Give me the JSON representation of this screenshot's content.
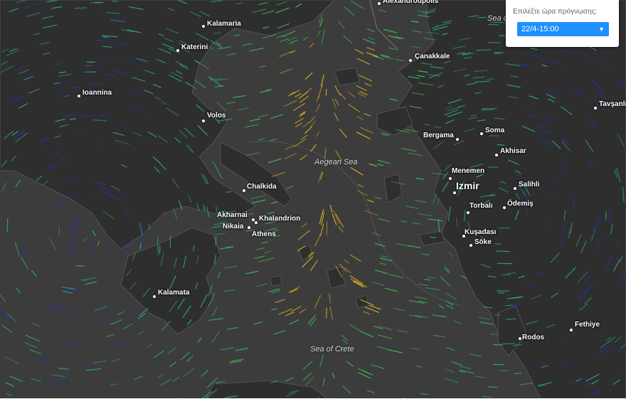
{
  "map": {
    "places": [
      {
        "name": "Kalamaria",
        "id": "kalamaria"
      },
      {
        "name": "Katerini",
        "id": "katerini"
      },
      {
        "name": "Ioannina",
        "id": "ioannina"
      },
      {
        "name": "Volos",
        "id": "volos"
      },
      {
        "name": "Chalkida",
        "id": "chalkida"
      },
      {
        "name": "Akharnai",
        "id": "akharnai"
      },
      {
        "name": "Khalandrion",
        "id": "khalandrion"
      },
      {
        "name": "Nikaia",
        "id": "nikaia"
      },
      {
        "name": "Athens",
        "id": "athens"
      },
      {
        "name": "Kalamata",
        "id": "kalamata"
      },
      {
        "name": "Alexandroupolis",
        "id": "alexandroupolis"
      },
      {
        "name": "Çanakkale",
        "id": "canakkale"
      },
      {
        "name": "Bergama",
        "id": "bergama"
      },
      {
        "name": "Soma",
        "id": "soma"
      },
      {
        "name": "Akhisar",
        "id": "akhisar"
      },
      {
        "name": "Menemen",
        "id": "menemen"
      },
      {
        "name": "Izmir",
        "id": "izmir"
      },
      {
        "name": "Salihli",
        "id": "salihli"
      },
      {
        "name": "Torbalı",
        "id": "torbali"
      },
      {
        "name": "Ödemiş",
        "id": "odemis"
      },
      {
        "name": "Kuşadası",
        "id": "kusadasi"
      },
      {
        "name": "Söke",
        "id": "soke"
      },
      {
        "name": "Tavşanlı",
        "id": "tavsanli"
      },
      {
        "name": "Fethiye",
        "id": "fethiye"
      },
      {
        "name": "Rodos",
        "id": "rodos"
      },
      {
        "name": "Soma",
        "id": "soma2"
      }
    ],
    "seas": {
      "aegean": "Aegean Sea",
      "crete": "Sea of Crete",
      "marmara": "Sea o"
    },
    "wind_colors": {
      "calm": "#2b2fa8",
      "light": "#2ea88a",
      "moderate": "#3ec25a",
      "strong": "#e0b020"
    }
  },
  "forecast_panel": {
    "label": "Επιλέξτε ώρα πρόγνωσης:",
    "selected": "22/4-15:00",
    "accent": "#1e90ff"
  }
}
